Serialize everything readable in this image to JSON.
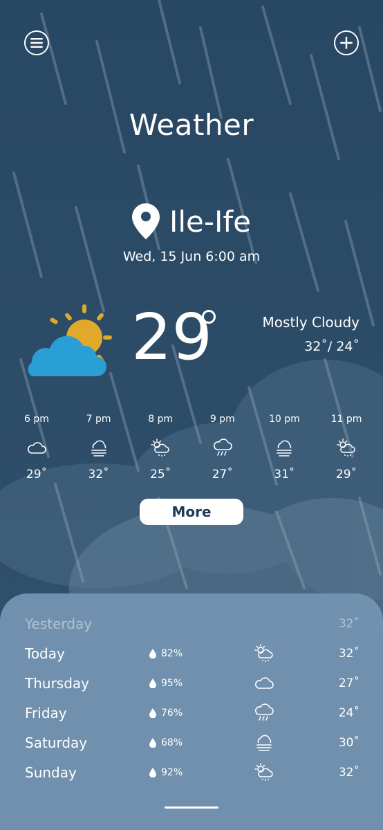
{
  "header": {
    "title": "Weather",
    "menu_icon": "hamburger-menu-icon",
    "add_icon": "plus-icon"
  },
  "location": {
    "name": "Ile-Ife",
    "icon": "location-pin-icon",
    "datetime": "Wed, 15 Jun 6:00 am"
  },
  "current": {
    "temperature": "29",
    "condition": "Mostly Cloudy",
    "hilo": "32˚/ 24˚",
    "icon": "partly-sunny-icon"
  },
  "hourly": [
    {
      "time": "6 pm",
      "temp": "29˚",
      "icon": "cloud-icon"
    },
    {
      "time": "7 pm",
      "temp": "32˚",
      "icon": "fog-icon"
    },
    {
      "time": "8 pm",
      "temp": "25˚",
      "icon": "sun-cloud-rain-icon"
    },
    {
      "time": "9 pm",
      "temp": "27˚",
      "icon": "rain-cloud-icon"
    },
    {
      "time": "10 pm",
      "temp": "31˚",
      "icon": "fog-icon"
    },
    {
      "time": "11 pm",
      "temp": "29˚",
      "icon": "sun-cloud-rain-icon"
    }
  ],
  "more_label": "More",
  "daily": [
    {
      "day": "Yesterday",
      "humidity": "",
      "temp": "32˚",
      "icon": ""
    },
    {
      "day": "Today",
      "humidity": "82%",
      "temp": "32˚",
      "icon": "sun-cloud-rain-icon"
    },
    {
      "day": "Thursday",
      "humidity": "95%",
      "temp": "27˚",
      "icon": "cloud-icon"
    },
    {
      "day": "Friday",
      "humidity": "76%",
      "temp": "24˚",
      "icon": "rain-cloud-icon"
    },
    {
      "day": "Saturday",
      "humidity": "68%",
      "temp": "30˚",
      "icon": "fog-icon"
    },
    {
      "day": "Sunday",
      "humidity": "92%",
      "temp": "32˚",
      "icon": "sun-cloud-rain-icon"
    }
  ],
  "colors": {
    "background": "#2b4a66",
    "sheet": "#7393b0",
    "sun": "#e0a92a",
    "cloud": "#2a9fd6",
    "button_text": "#1f3a58"
  }
}
